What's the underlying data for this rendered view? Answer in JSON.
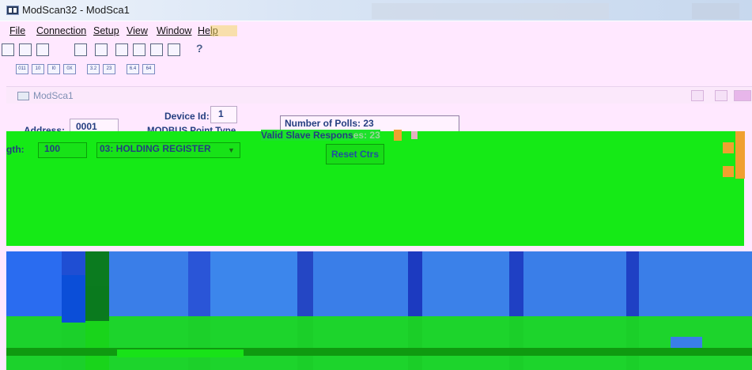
{
  "window": {
    "title": "ModScan32 - ModSca1"
  },
  "menu": {
    "items": [
      "File",
      "Connection",
      "Setup",
      "View",
      "Window",
      "Help"
    ]
  },
  "child": {
    "title": "ModSca1"
  },
  "form": {
    "device_id_label": "Device Id:",
    "device_id_value": "1",
    "address_label": "Address:",
    "address_value": "0001",
    "point_type_label": "MODBUS Point Type",
    "length_label": "gth:",
    "length_value": "100",
    "point_type_value": "03: HOLDING REGISTER",
    "polls_label": "Number of Polls: 23",
    "valid_label": "Valid Slave Respons",
    "valid_value": "es: 23",
    "reset_label": "Reset Ctrs"
  },
  "colors": {
    "accent_green": "#15ea16",
    "data_blue": "#3a7ee8",
    "label_blue": "#243e80"
  }
}
